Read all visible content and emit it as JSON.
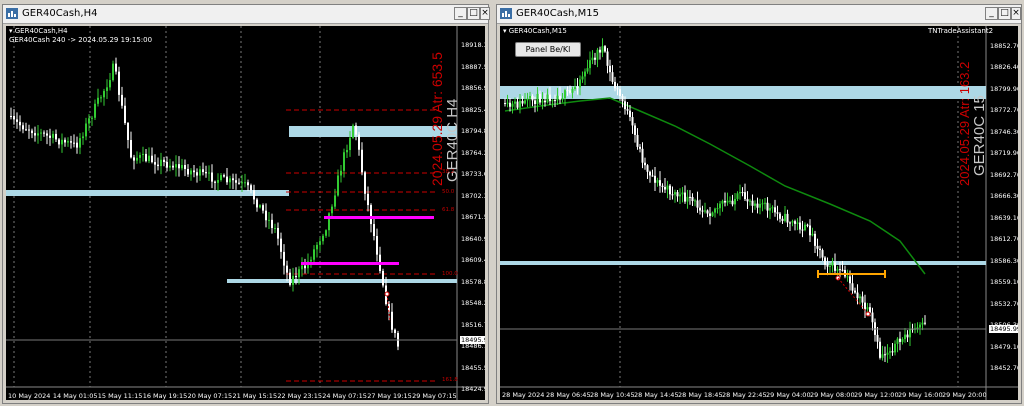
{
  "left_window": {
    "title": "GER40Cash,H4",
    "chart_label": "GER40Cash,H4",
    "info_line": "GER40Cash 240 -> 2024.05.29 19:15:00",
    "big_symbol": "GER40C H4",
    "big_date": "2024.05.29 Atr: 653.5",
    "current_price_tag": "18495.99",
    "price_axis": [
      "18918.30",
      "18887.50",
      "18856.90",
      "18825.40",
      "18794.80",
      "18764.20",
      "18733.60",
      "18702.30",
      "18671.50",
      "18640.90",
      "18609.40",
      "18578.80",
      "18548.20",
      "18516.70",
      "18486.10",
      "18455.50",
      "18424.90"
    ],
    "time_axis": [
      "10 May 2024",
      "14 May 01:05",
      "15 May 11:15",
      "16 May 19:15",
      "20 May 07:15",
      "21 May 15:15",
      "22 May 23:15",
      "24 May 07:15",
      "27 May 19:15",
      "29 May 07:15"
    ],
    "fib_labels": [
      "38.2",
      "50.0",
      "61.8",
      "100.0",
      "161.8"
    ],
    "colors": {
      "bull": "#33cc33",
      "bear": "#ffffff",
      "zone": "#add8e6",
      "magenta": "#ff00ff",
      "fib": "#cc0000",
      "date_text": "#cc0000",
      "symbol_text": "#c8c8c8"
    }
  },
  "right_window": {
    "title": "GER40Cash,M15",
    "chart_label": "GER40Cash,M15",
    "indicator_label": "TNTradeAssistant2",
    "panel_button": "Panel Be/Kl",
    "big_symbol": "GER40C 15",
    "big_date": "2024.05.29 Atr: 163.2",
    "current_price_tag": "18495.99",
    "price_axis": [
      "18852.70",
      "18826.40",
      "18799.90",
      "18772.70",
      "18746.30",
      "18719.90",
      "18692.70",
      "18666.30",
      "18639.10",
      "18612.70",
      "18586.30",
      "18559.10",
      "18532.70",
      "18506.30",
      "18479.10",
      "18452.70"
    ],
    "time_axis": [
      "28 May 2024",
      "28 May 06:45",
      "28 May 10:45",
      "28 May 14:45",
      "28 May 18:45",
      "28 May 22:45",
      "29 May 04:00",
      "29 May 08:00",
      "29 May 12:00",
      "29 May 16:00",
      "29 May 20:00"
    ],
    "colors": {
      "bull": "#33cc33",
      "bear": "#ffffff",
      "zone": "#add8e6",
      "ma": "#0e8a0e",
      "trade_line": "#ffa500",
      "date_text": "#cc0000"
    }
  },
  "titlebar_buttons": {
    "minimize": "_",
    "maximize": "□",
    "close": "×"
  }
}
